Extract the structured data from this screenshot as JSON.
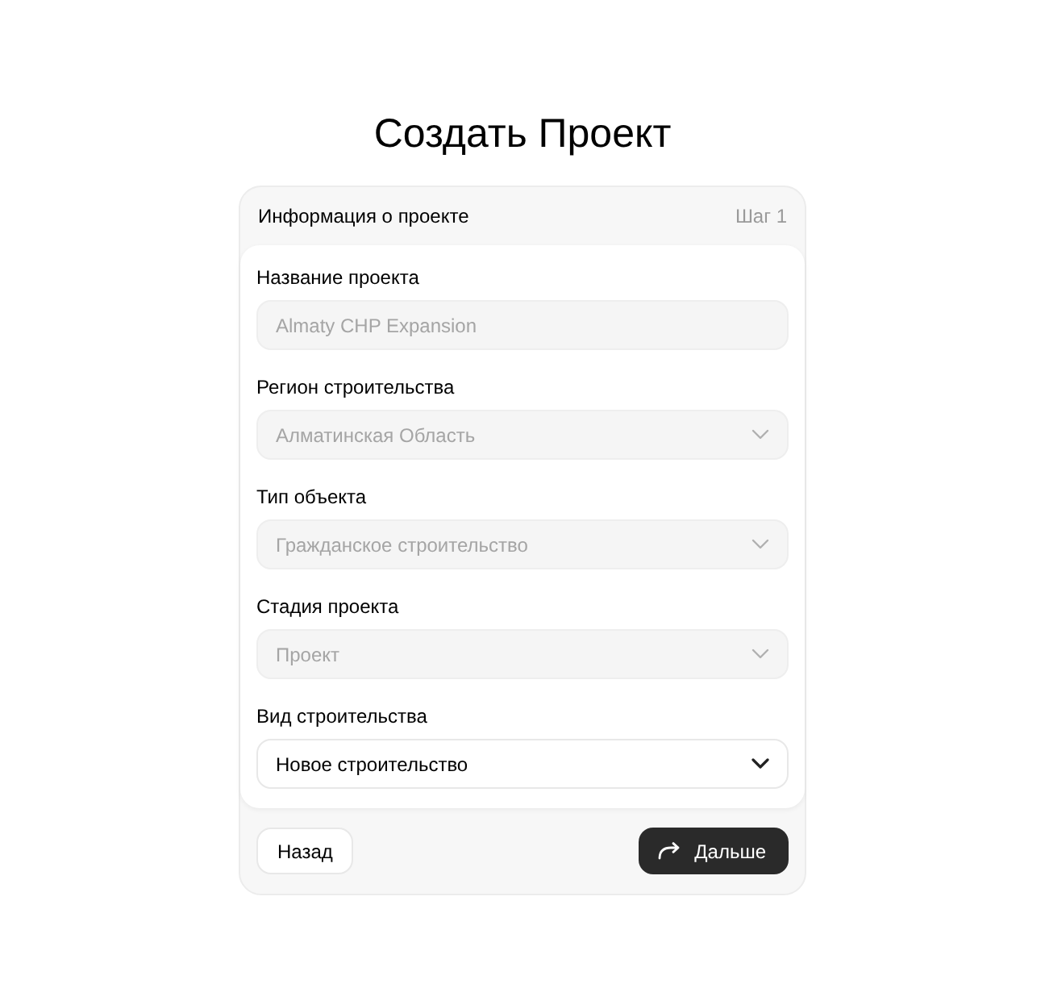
{
  "title": "Создать Проект",
  "card": {
    "heading": "Информация о проекте",
    "step": "Шаг 1"
  },
  "fields": [
    {
      "kind": "text",
      "label": "Название проекта",
      "value": "Almaty CHP Expansion",
      "disabled": true
    },
    {
      "kind": "select",
      "label": "Регион строительства",
      "value": "Алматинская Область",
      "disabled": true
    },
    {
      "kind": "select",
      "label": "Тип объекта",
      "value": "Гражданское строительство",
      "disabled": true
    },
    {
      "kind": "select",
      "label": "Стадия проекта",
      "value": "Проект",
      "disabled": true
    },
    {
      "kind": "select",
      "label": "Вид строительства",
      "value": "Новое строительство",
      "disabled": false
    }
  ],
  "buttons": {
    "back": "Назад",
    "next": "Дальше"
  }
}
